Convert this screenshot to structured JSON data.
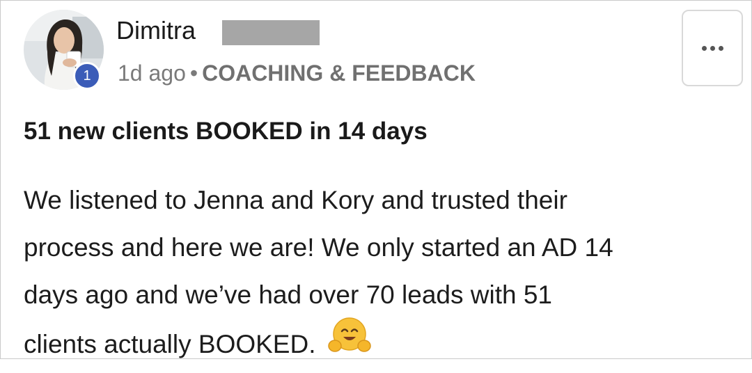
{
  "post": {
    "author_name": "Dimitra",
    "level": "1",
    "time_ago": "1d ago",
    "separator": "•",
    "category": "COACHING & FEEDBACK",
    "title": "51 new clients BOOKED in 14 days",
    "body_lines": [
      "We listened to Jenna and Kory and trusted their",
      "process and here we are! We only started an AD 14",
      "days ago and we’ve had over 70 leads with 51",
      "clients actually BOOKED."
    ],
    "emoji": "hugging-face-emoji"
  },
  "icons": {
    "more": "more-horizontal-icon"
  },
  "colors": {
    "level_badge": "#3b5cb8",
    "meta_text": "#7a7a7a",
    "redaction": "#a6a6a6"
  }
}
